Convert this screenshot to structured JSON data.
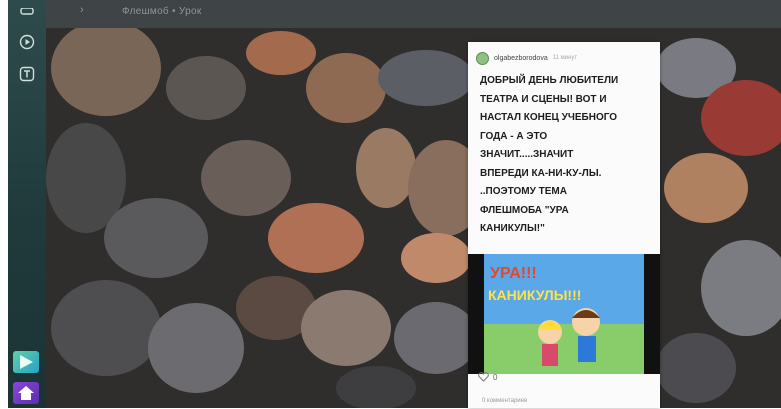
{
  "topbar": {
    "crumb": "Флешмоб • Урок",
    "arrow": "›"
  },
  "post": {
    "username": "olgabezborodova",
    "time": "11 минут",
    "text": "ДОБРЫЙ ДЕНЬ ЛЮБИТЕЛИ\nТЕАТРА И СЦЕНЫ! ВОТ И\nНАСТАЛ КОНЕЦ УЧЕБНОГО\nГОДА - А ЭТО\nЗНАЧИТ.....ЗНАЧИТ\nВПЕРЕДИ КА-НИ-КУ-ЛЫ.\n..ПОЭТОМУ ТЕМА\nФЛЕШМОБА \"УРА\nКАНИКУЛЫ!\"",
    "image_text_top": "УРА!!!",
    "image_text_bottom": "КАНИКУЛЫ!!!",
    "likes": "0",
    "comments": "0 комментариев"
  },
  "icons": [
    "play-circle-icon",
    "text-t-icon",
    "app-dock-icon",
    "home-icon"
  ],
  "colors": {
    "sidebar": "#203a3b",
    "topbar": "#3f4446",
    "card": "#fbfbfb"
  }
}
